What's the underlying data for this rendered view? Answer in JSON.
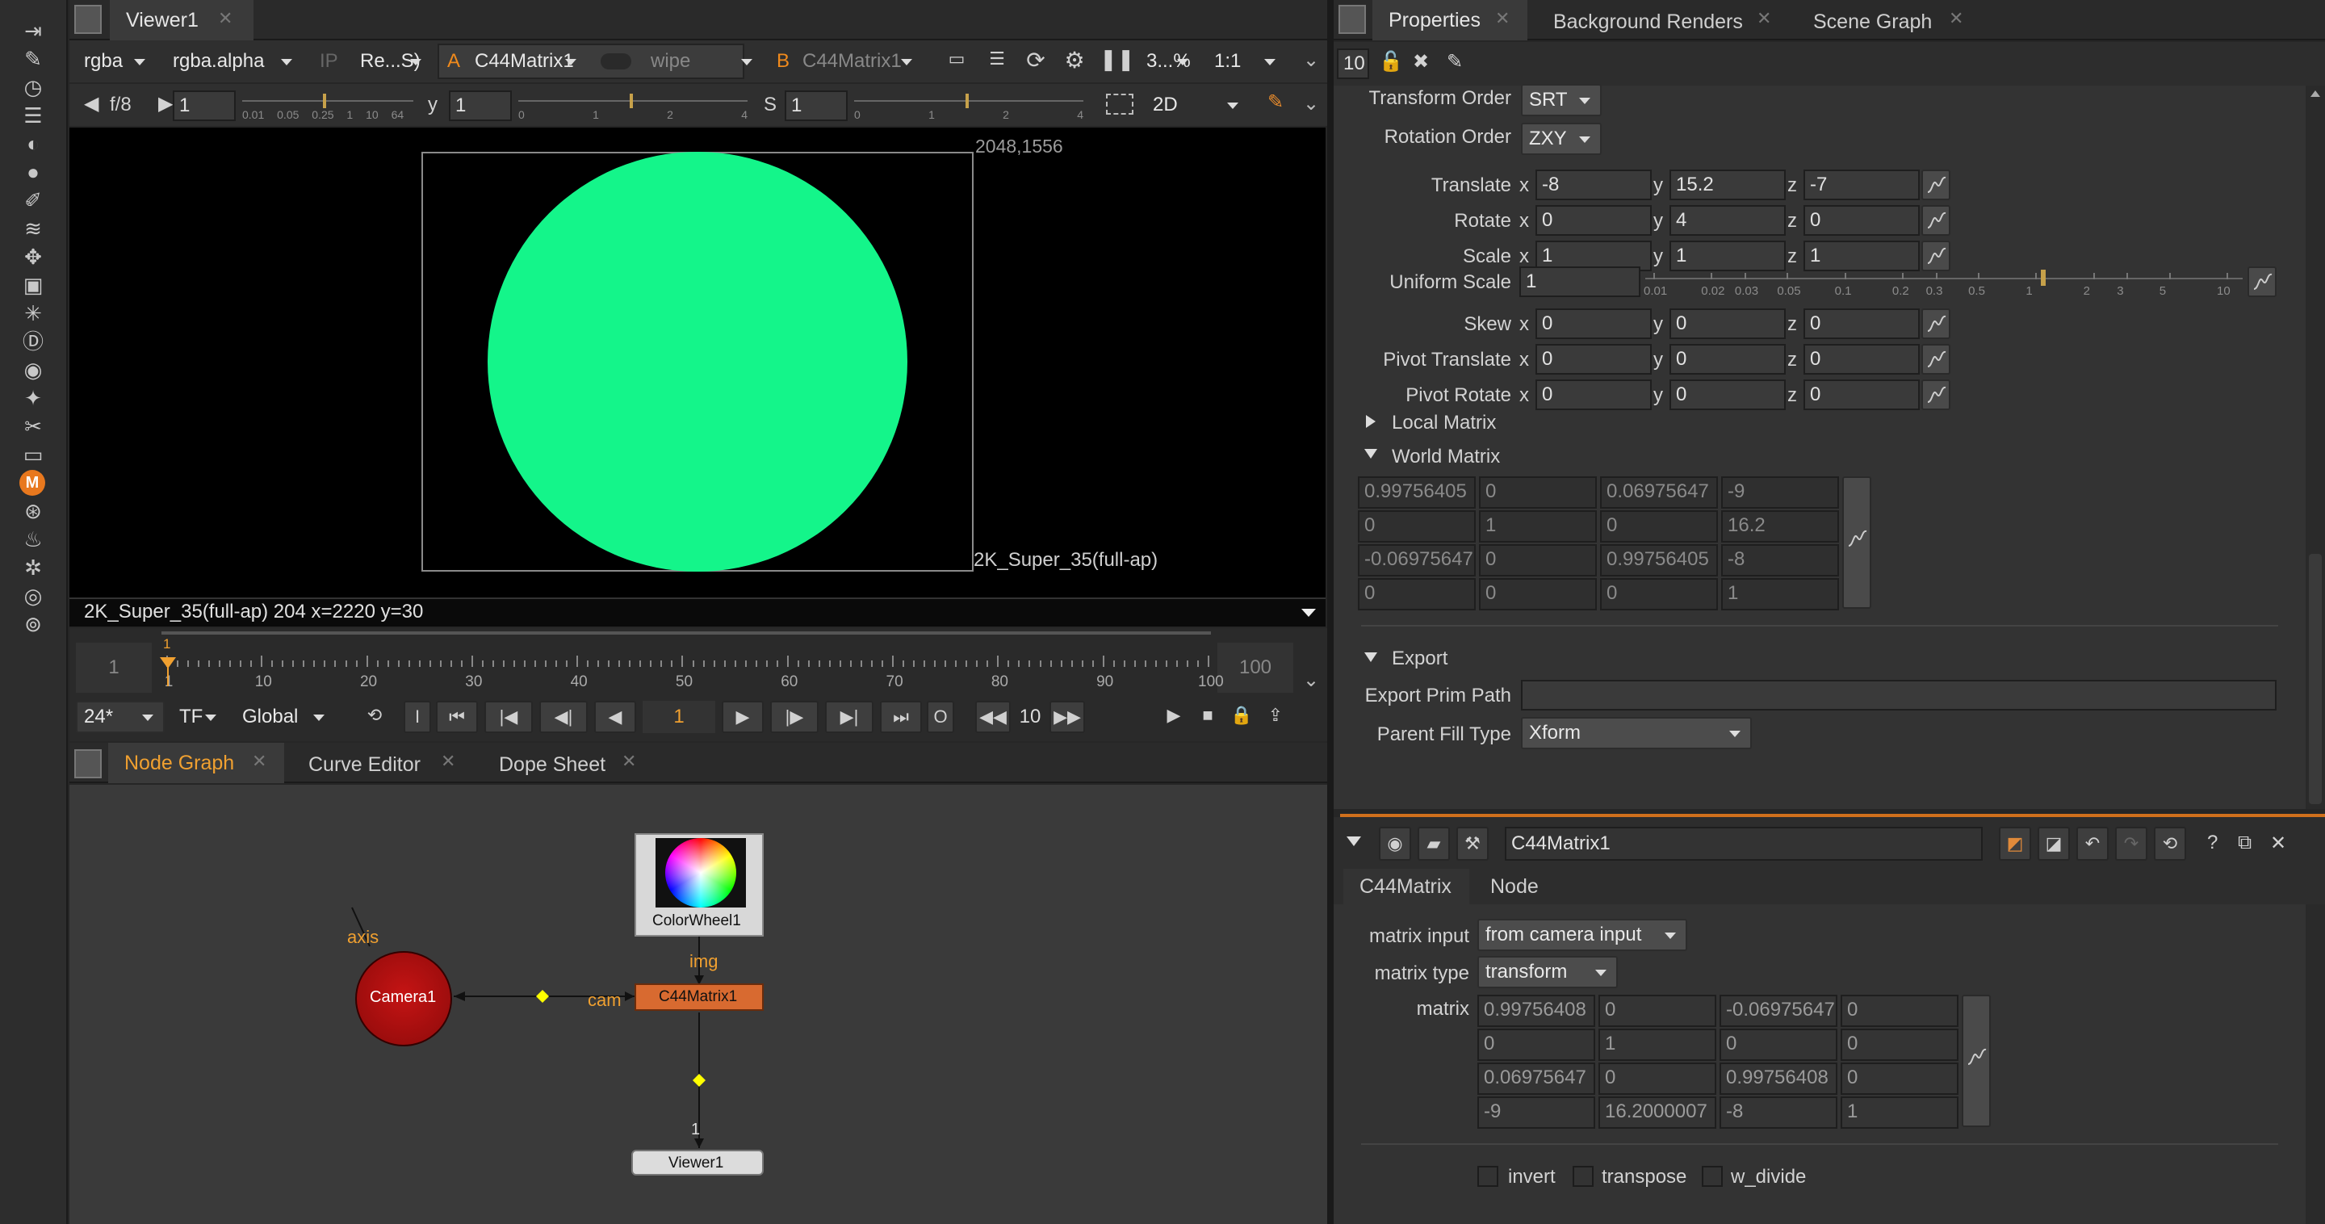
{
  "viewer": {
    "tab_title": "Viewer1",
    "channels": "rgba",
    "alpha": "rgba.alpha",
    "ip": "IP",
    "resize": "Re...S)",
    "a_label": "A",
    "a_input": "C44Matrix1",
    "wipe": "wipe",
    "b_label": "B",
    "b_input": "C44Matrix1",
    "zoom": "3...%",
    "ratio": "1:1",
    "fstop": "f/8",
    "gain": "1",
    "gamma_label": "y",
    "gamma": "1",
    "s_label": "S",
    "saturation": "1",
    "gain_ticks": [
      "0.01",
      "0.05",
      "0.25",
      "1",
      "10",
      "64"
    ],
    "gamma_ticks": [
      "0",
      "1",
      "2",
      "4"
    ],
    "sat_ticks": [
      "0",
      "1",
      "2",
      "4"
    ],
    "view_mode": "2D",
    "format_top": "2048,1556",
    "format_name": "2K_Super_35(full-ap)",
    "status": "2K_Super_35(full-ap) 204  x=2220 y=30",
    "circle_color": "#14f58a"
  },
  "timeline": {
    "start": "1",
    "end": "100",
    "cursor": "1",
    "ticks": [
      "1",
      "10",
      "20",
      "30",
      "40",
      "50",
      "60",
      "70",
      "80",
      "90",
      "100"
    ],
    "fps": "24*",
    "tf": "TF",
    "global": "Global",
    "i_btn": "I",
    "o_btn": "O",
    "current_frame": "1",
    "step": "10"
  },
  "nodegraph": {
    "tabs": [
      "Node Graph",
      "Curve Editor",
      "Dope Sheet"
    ],
    "nodes": {
      "camera": "Camera1",
      "colorwheel": "ColorWheel1",
      "c44": "C44Matrix1",
      "viewer": "Viewer1"
    },
    "labels": {
      "axis": "axis",
      "cam": "cam",
      "img": "img",
      "one": "1"
    }
  },
  "properties": {
    "tabs": [
      "Properties",
      "Background Renders",
      "Scene Graph"
    ],
    "max_panels": "10",
    "transform_order_label": "Transform Order",
    "transform_order": "SRT",
    "rotation_order_label": "Rotation Order",
    "rotation_order": "ZXY",
    "rows": [
      {
        "label": "Translate",
        "x": "-8",
        "y": "15.2",
        "z": "-7"
      },
      {
        "label": "Rotate",
        "x": "0",
        "y": "4",
        "z": "0"
      },
      {
        "label": "Scale",
        "x": "1",
        "y": "1",
        "z": "1"
      },
      {
        "label": "Skew",
        "x": "0",
        "y": "0",
        "z": "0"
      },
      {
        "label": "Pivot Translate",
        "x": "0",
        "y": "0",
        "z": "0"
      },
      {
        "label": "Pivot Rotate",
        "x": "0",
        "y": "0",
        "z": "0"
      }
    ],
    "uniform_scale_label": "Uniform Scale",
    "uniform_scale": "1",
    "uniform_ticks": [
      "0.01",
      "0.02",
      "0.03",
      "0.05",
      "0.1",
      "0.2",
      "0.3",
      "0.5",
      "1",
      "2",
      "3",
      "5",
      "10"
    ],
    "axis_x": "x",
    "axis_y": "y",
    "axis_z": "z",
    "local_matrix": "Local Matrix",
    "world_matrix": "World Matrix",
    "world": [
      [
        "0.99756405",
        "0",
        "0.06975647",
        "-9"
      ],
      [
        "0",
        "1",
        "0",
        "16.2"
      ],
      [
        "-0.06975647",
        "0",
        "0.99756405",
        "-8"
      ],
      [
        "0",
        "0",
        "0",
        "1"
      ]
    ],
    "export": "Export",
    "export_prim_label": "Export Prim Path",
    "export_prim": "",
    "parent_fill_label": "Parent Fill Type",
    "parent_fill": "Xform"
  },
  "c44": {
    "name": "C44Matrix1",
    "tabs": [
      "C44Matrix",
      "Node"
    ],
    "matrix_input_label": "matrix input",
    "matrix_input": "from camera input",
    "matrix_type_label": "matrix type",
    "matrix_type": "transform",
    "matrix_label": "matrix",
    "matrix": [
      [
        "0.99756408",
        "0",
        "-0.06975647",
        "0"
      ],
      [
        "0",
        "1",
        "0",
        "0"
      ],
      [
        "0.06975647",
        "0",
        "0.99756408",
        "0"
      ],
      [
        "-9",
        "16.2000007",
        "-8",
        "1"
      ]
    ],
    "invert": "invert",
    "transpose": "transpose",
    "w_divide": "w_divide"
  },
  "toolbar_icons": [
    "read-icon",
    "draw-icon",
    "time-icon",
    "channel-icon",
    "color-icon",
    "filter-icon",
    "keyer-icon",
    "merge-icon",
    "transform-icon",
    "3d-icon",
    "particles-icon",
    "deep-icon",
    "views-icon",
    "metadata-icon",
    "toolsets-icon",
    "other-icon",
    "m-icon",
    "usd-icon",
    "furnace-icon",
    "cara-icon",
    "ocula-icon",
    "gizmo-icon"
  ]
}
